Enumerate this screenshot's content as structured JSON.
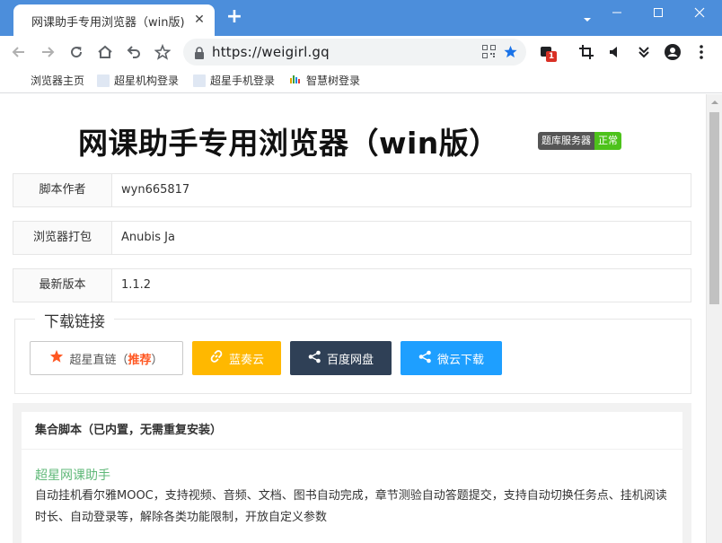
{
  "browser": {
    "tab_title": "网课助手专用浏览器（win版)",
    "tab_close": "✕",
    "new_tab": "+",
    "url": "https://weigirl.gq",
    "extension_badge": "1",
    "accent_color": "#4c8edb",
    "icons": [
      "back-icon",
      "forward-icon",
      "reload-icon",
      "home-icon",
      "undo-icon",
      "star-icon",
      "lock-icon",
      "qrcode-icon",
      "bookmark-star-icon",
      "extension-icon",
      "crop-icon",
      "volume-icon",
      "chevrons-down-icon",
      "account-icon",
      "more-icon"
    ]
  },
  "bookmarks": [
    {
      "label": "浏览器主页"
    },
    {
      "label": "超星机构登录"
    },
    {
      "label": "超星手机登录"
    },
    {
      "label": "智慧树登录"
    }
  ],
  "page": {
    "title": "网课助手专用浏览器（win版）",
    "status_label": "题库服务器",
    "status_value": "正常",
    "info": [
      {
        "label": "脚本作者",
        "value": "wyn665817"
      },
      {
        "label": "浏览器打包",
        "value": "Anubis Ja"
      },
      {
        "label": "最新版本",
        "value": "1.1.2"
      }
    ],
    "download": {
      "legend": "下载链接",
      "chaoxing_label": "超星直链（",
      "chaoxing_highlight": "推荐",
      "chaoxing_suffix": "）",
      "lanzou_label": "蓝奏云",
      "baidu_label": "百度网盘",
      "weiyun_label": "微云下载"
    },
    "scripts_panel": {
      "header": "集合脚本（已内置，无需重复安装）",
      "item_title": "超星网课助手",
      "item_desc": "自动挂机看尔雅MOOC，支持视频、音频、文档、图书自动完成，章节测验自动答题提交，支持自动切换任务点、挂机阅读时长、自动登录等，解除各类功能限制，开放自定义参数"
    }
  }
}
